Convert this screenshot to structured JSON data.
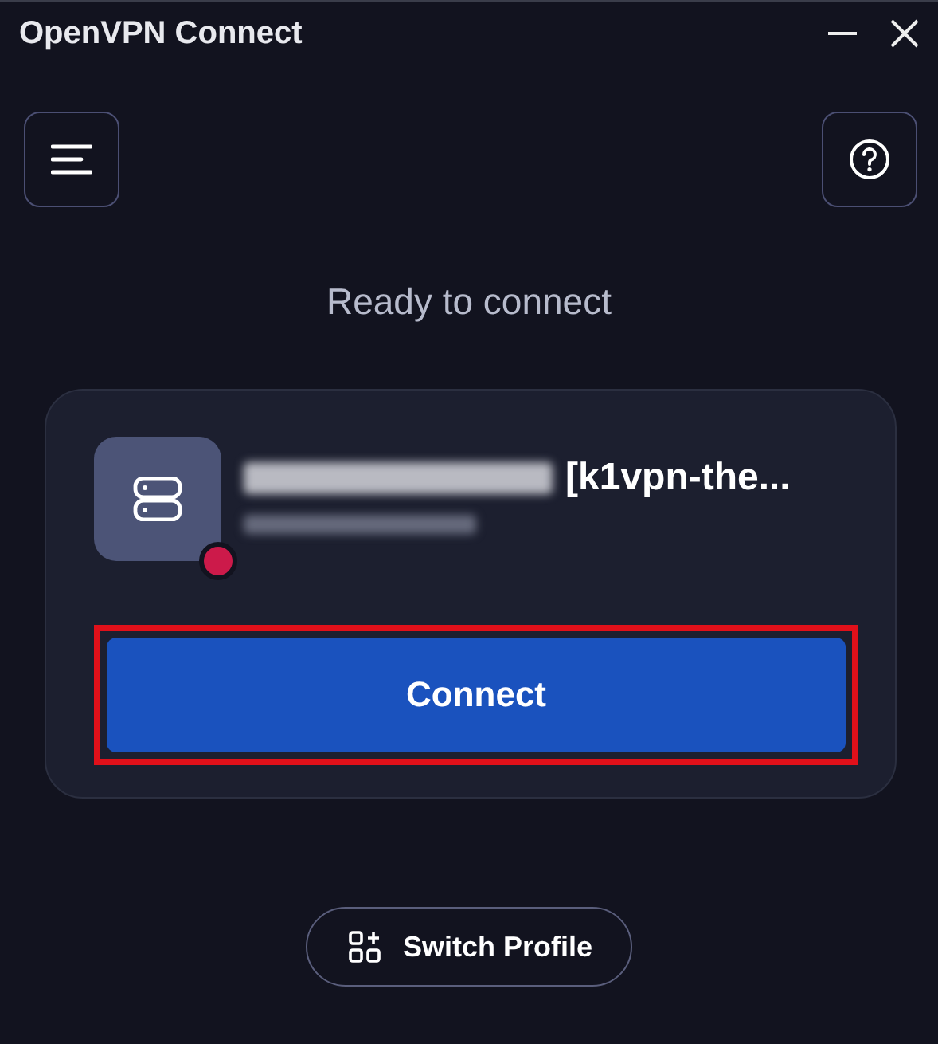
{
  "window": {
    "title": "OpenVPN Connect"
  },
  "status": "Ready to connect",
  "profile": {
    "name_suffix": "[k1vpn-the...",
    "connected": false
  },
  "connect_button": {
    "label": "Connect",
    "highlighted": true
  },
  "switch_button": {
    "label": "Switch Profile"
  }
}
